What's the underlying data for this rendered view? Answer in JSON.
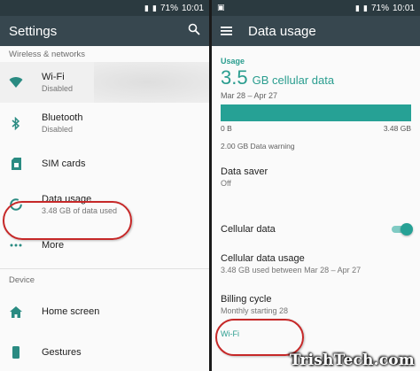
{
  "status": {
    "battery": "71%",
    "time": "10:01"
  },
  "left": {
    "title": "Settings",
    "search_icon": "search-icon",
    "section_wireless": "Wireless & networks",
    "section_device": "Device",
    "items": [
      {
        "title": "Wi-Fi",
        "subtitle": "Disabled",
        "icon": "wifi-icon"
      },
      {
        "title": "Bluetooth",
        "subtitle": "Disabled",
        "icon": "bluetooth-icon"
      },
      {
        "title": "SIM cards",
        "subtitle": "",
        "icon": "sim-card-icon"
      },
      {
        "title": "Data usage",
        "subtitle": "3.48 GB of data used",
        "icon": "data-usage-icon"
      },
      {
        "title": "More",
        "subtitle": "",
        "icon": "more-dots-icon"
      }
    ],
    "device_items": [
      {
        "title": "Home screen",
        "icon": "home-icon"
      },
      {
        "title": "Gestures",
        "icon": "gestures-icon"
      }
    ]
  },
  "right": {
    "title": "Data usage",
    "menu_icon": "menu-icon",
    "usage_label": "Usage",
    "usage_amount": "3.5",
    "usage_unit": "GB cellular data",
    "date_range": "Mar 28 – Apr 27",
    "bar_min": "0 B",
    "bar_max": "3.48 GB",
    "bar_fill_fraction": 1.0,
    "warning": "2.00 GB Data warning",
    "data_saver_title": "Data saver",
    "data_saver_value": "Off",
    "cellular_data_title": "Cellular data",
    "cellular_data_on": true,
    "cellular_usage_title": "Cellular data usage",
    "cellular_usage_sub": "3.48 GB used between Mar 28 – Apr 27",
    "billing_title": "Billing cycle",
    "billing_sub": "Monthly starting 28",
    "partial_text": "Wi-Fi"
  },
  "colors": {
    "accent": "#26a195",
    "appbar": "#37474f",
    "statusbar": "#2b3a40",
    "highlight": "#c62828"
  },
  "watermark": "TrishTech.com"
}
